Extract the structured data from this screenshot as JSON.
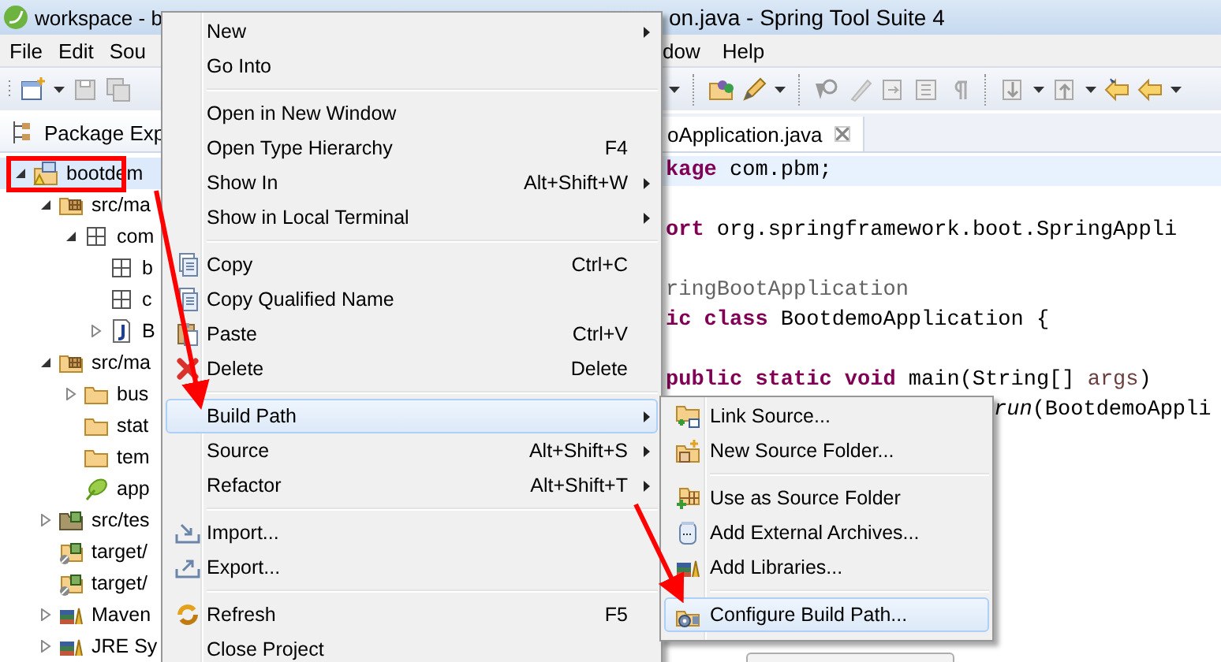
{
  "window": {
    "title_left": "workspace - b",
    "title_right": "on.java - Spring Tool Suite 4"
  },
  "menu_bar": {
    "items_left": [
      "File",
      "Edit",
      "Sou"
    ],
    "items_right": [
      "dow",
      "Help"
    ]
  },
  "package_explorer": {
    "title": "Package Exp",
    "tree": [
      {
        "label": "bootdem",
        "kind": "project",
        "expanded": true,
        "selected": true,
        "children": [
          {
            "label": "src/ma",
            "kind": "source-folder",
            "expanded": true,
            "selected": false,
            "children": [
              {
                "label": "com",
                "kind": "package",
                "expanded": true,
                "selected": false,
                "children": [
                  {
                    "label": "b",
                    "kind": "package",
                    "selected": false
                  },
                  {
                    "label": "c",
                    "kind": "package",
                    "selected": false
                  },
                  {
                    "label": "B",
                    "kind": "java-file",
                    "expanded": false,
                    "selected": false
                  }
                ]
              }
            ]
          },
          {
            "label": "src/ma",
            "kind": "resource-folder",
            "expanded": true,
            "selected": false,
            "children": [
              {
                "label": "bus",
                "kind": "folder",
                "expanded": false,
                "selected": false
              },
              {
                "label": "stat",
                "kind": "folder",
                "selected": false
              },
              {
                "label": "tem",
                "kind": "folder",
                "selected": false
              },
              {
                "label": "app",
                "kind": "spring-file",
                "selected": false
              }
            ]
          },
          {
            "label": "src/tes",
            "kind": "test-folder",
            "expanded": false,
            "selected": false
          },
          {
            "label": "target/",
            "kind": "output-folder",
            "selected": false
          },
          {
            "label": "target/",
            "kind": "output-folder",
            "selected": false
          },
          {
            "label": "Maven",
            "kind": "library",
            "expanded": false,
            "selected": false
          },
          {
            "label": "JRE Sy",
            "kind": "library",
            "expanded": false,
            "selected": false
          }
        ]
      }
    ]
  },
  "editor": {
    "tab": "oApplication.java",
    "lines": [
      {
        "kind": "code",
        "current": true,
        "partly_hidden": false,
        "tokens": [
          {
            "kind": "keyword",
            "text": "kage"
          },
          {
            "kind": "plain",
            "text": " com.pbm;"
          }
        ]
      },
      {
        "kind": "blank"
      },
      {
        "kind": "code",
        "current": false,
        "partly_hidden": false,
        "tokens": [
          {
            "kind": "keyword",
            "text": "ort"
          },
          {
            "kind": "plain",
            "text": " org.springframework.boot.SpringAppli"
          }
        ]
      },
      {
        "kind": "blank"
      },
      {
        "kind": "code",
        "current": false,
        "partly_hidden": false,
        "tokens": [
          {
            "kind": "annotation",
            "text": "ringBootApplication"
          }
        ]
      },
      {
        "kind": "code",
        "current": false,
        "partly_hidden": false,
        "tokens": [
          {
            "kind": "keyword",
            "text": "ic class"
          },
          {
            "kind": "plain",
            "text": " BootdemoApplication {"
          }
        ]
      },
      {
        "kind": "blank"
      },
      {
        "kind": "code",
        "current": false,
        "partly_hidden": false,
        "tokens": [
          {
            "kind": "keyword",
            "text": "public static void"
          },
          {
            "kind": "plain",
            "text": " main(String[] "
          },
          {
            "kind": "parameter",
            "text": "args"
          },
          {
            "kind": "plain",
            "text": ")"
          }
        ]
      },
      {
        "kind": "code",
        "current": false,
        "partly_hidden": true,
        "tokens": [
          {
            "kind": "static-call",
            "text": "run"
          },
          {
            "kind": "plain",
            "text": "(BootdemoAppli"
          }
        ]
      }
    ]
  },
  "context_menu": [
    {
      "kind": "item",
      "label": "New",
      "submenu": true,
      "selected": false
    },
    {
      "kind": "item",
      "label": "Go Into",
      "selected": false
    },
    {
      "kind": "separator"
    },
    {
      "kind": "item",
      "label": "Open in New Window",
      "selected": false
    },
    {
      "kind": "item",
      "label": "Open Type Hierarchy",
      "shortcut": "F4",
      "selected": false
    },
    {
      "kind": "item",
      "label": "Show In",
      "shortcut": "Alt+Shift+W",
      "submenu": true,
      "selected": false
    },
    {
      "kind": "item",
      "label": "Show in Local Terminal",
      "submenu": true,
      "selected": false
    },
    {
      "kind": "separator"
    },
    {
      "kind": "item",
      "label": "Copy",
      "shortcut": "Ctrl+C",
      "selected": false
    },
    {
      "kind": "item",
      "label": "Copy Qualified Name",
      "selected": false
    },
    {
      "kind": "item",
      "label": "Paste",
      "shortcut": "Ctrl+V",
      "selected": false
    },
    {
      "kind": "item",
      "label": "Delete",
      "shortcut": "Delete",
      "selected": false
    },
    {
      "kind": "separator"
    },
    {
      "kind": "item",
      "label": "Build Path",
      "submenu": true,
      "selected": true
    },
    {
      "kind": "item",
      "label": "Source",
      "shortcut": "Alt+Shift+S",
      "submenu": true,
      "selected": false
    },
    {
      "kind": "item",
      "label": "Refactor",
      "shortcut": "Alt+Shift+T",
      "submenu": true,
      "selected": false
    },
    {
      "kind": "separator"
    },
    {
      "kind": "item",
      "label": "Import...",
      "selected": false
    },
    {
      "kind": "item",
      "label": "Export...",
      "selected": false
    },
    {
      "kind": "separator"
    },
    {
      "kind": "item",
      "label": "Refresh",
      "shortcut": "F5",
      "selected": false
    },
    {
      "kind": "item",
      "label": "Close Project",
      "selected": false
    }
  ],
  "build_path_submenu": [
    {
      "kind": "item",
      "label": "Link Source...",
      "selected": false
    },
    {
      "kind": "item",
      "label": "New Source Folder...",
      "selected": false
    },
    {
      "kind": "separator"
    },
    {
      "kind": "item",
      "label": "Use as Source Folder",
      "selected": false
    },
    {
      "kind": "item",
      "label": "Add External Archives...",
      "selected": false
    },
    {
      "kind": "item",
      "label": "Add Libraries...",
      "selected": false
    },
    {
      "kind": "separator"
    },
    {
      "kind": "item",
      "label": "Configure Build Path...",
      "selected": true
    }
  ]
}
